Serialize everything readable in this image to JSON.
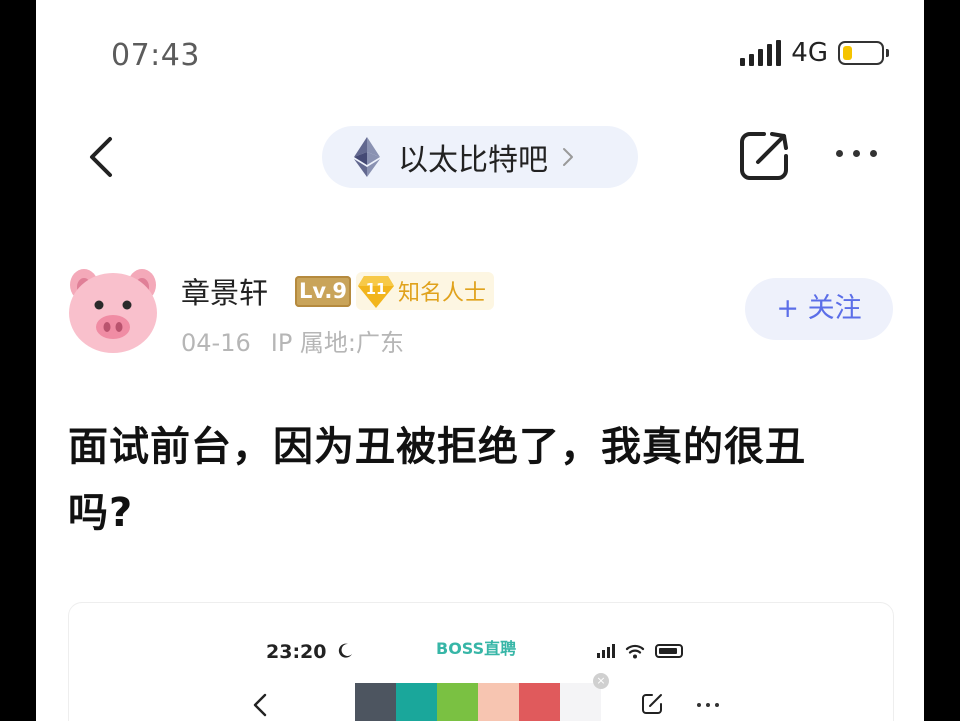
{
  "status_bar": {
    "time": "07:43",
    "network": "4G",
    "battery_level": 0.25,
    "colors": {
      "battery_fill": "#f5c400"
    }
  },
  "nav": {
    "back_icon": "chevron-left-icon",
    "forum_icon": "ethereum-logo-icon",
    "forum_name": "以太比特吧",
    "forum_chevron_icon": "chevron-right-icon",
    "share_icon": "share-icon",
    "more_icon": "more-dots-icon",
    "colors": {
      "pill_bg": "#eef2fb"
    }
  },
  "post": {
    "author": {
      "avatar_icon": "pig-emoji-avatar",
      "name": "章景轩",
      "level_badge": "Lv.9",
      "honor_number": "11",
      "honor_label": "知名人士",
      "date": "04-16",
      "ip_location": "IP 属地:广东"
    },
    "follow_label": "+ 关注",
    "title": "面试前台，因为丑被拒绝了，我真的很丑吗?",
    "colors": {
      "follow_text": "#5b6ee8",
      "honor_text": "#e0a21c",
      "level_bg": "#c9a45a"
    }
  },
  "embedded_screenshot": {
    "time": "23:20",
    "moon_icon": "moon-icon",
    "brand": "BOSS直聘",
    "wifi_icon": "wifi-icon",
    "back_icon": "chevron-left-icon",
    "close_icon": "close-icon",
    "close_glyph": "×",
    "edit_icon": "edit-icon",
    "more_icon": "more-dots-icon",
    "swatch_colors": [
      "#4d5560",
      "#1aa79b",
      "#7ac142",
      "#f7c5b1",
      "#e05a5c",
      "#f4f4f6"
    ]
  }
}
